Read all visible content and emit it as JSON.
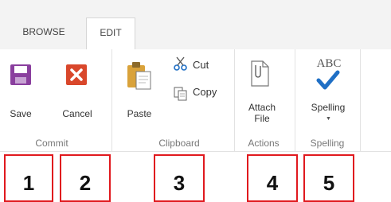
{
  "tabs": [
    {
      "label": "BROWSE",
      "active": false
    },
    {
      "label": "EDIT",
      "active": true
    }
  ],
  "groups": {
    "commit": {
      "label": "Commit",
      "buttons": [
        {
          "label": "Save",
          "icon": "save-icon"
        },
        {
          "label": "Cancel",
          "icon": "cancel-icon"
        }
      ]
    },
    "clipboard": {
      "label": "Clipboard",
      "paste": {
        "label": "Paste",
        "icon": "paste-icon"
      },
      "cut": {
        "label": "Cut",
        "icon": "cut-icon"
      },
      "copy": {
        "label": "Copy",
        "icon": "copy-icon"
      }
    },
    "actions": {
      "label": "Actions",
      "attach": {
        "line1": "Attach",
        "line2": "File",
        "icon": "attach-file-icon"
      }
    },
    "spelling": {
      "label": "Spelling",
      "spell": {
        "label": "Spelling",
        "icon": "spelling-icon",
        "icon_text": "ABC"
      }
    }
  },
  "callouts": [
    "1",
    "2",
    "3",
    "4",
    "5"
  ],
  "colors": {
    "save_purple": "#8a3f9e",
    "cancel_red": "#d9472b",
    "callout_border": "#e0191e",
    "check_blue": "#1f6fc5"
  }
}
